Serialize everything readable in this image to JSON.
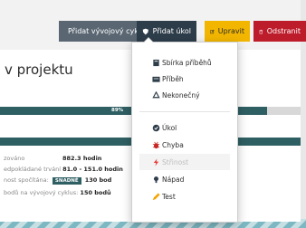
{
  "toolbar": {
    "add_cycle": "Přidat vývojový cyklus",
    "add_task": "Přidat úkol",
    "edit": "Upravit",
    "delete": "Odstranit"
  },
  "page": {
    "title_fragment": "v projektu",
    "progress_label": "89%",
    "progress_value": 0.89
  },
  "stats": {
    "row1_label": "zováno",
    "row1_value": "882.3 hodin",
    "row2_label": "edpokládané trvání",
    "row2_value": "81.0 - 151.0 hodin",
    "row3_label": "nost spočítána:",
    "row3_badge": "SNADNÉ",
    "row3_value": "130 bod",
    "row4_label": "bodů na vývojový cyklus:",
    "row4_value": "150 bodů"
  },
  "menu": {
    "items": [
      {
        "label": "Sbírka příběhů",
        "icon": "book-icon"
      },
      {
        "label": "Příběh",
        "icon": "card-icon"
      },
      {
        "label": "Nekonečný",
        "icon": "recycle-icon"
      },
      {
        "label": "Úkol",
        "icon": "check-circle-icon"
      },
      {
        "label": "Chyba",
        "icon": "bug-icon"
      },
      {
        "label": "Střinost",
        "icon": "lightning-icon"
      },
      {
        "label": "Nápad",
        "icon": "lightbulb-icon"
      },
      {
        "label": "Test",
        "icon": "pencil-icon"
      }
    ]
  },
  "colors": {
    "accent": "#2e5f63",
    "edit": "#f2b600",
    "delete": "#bd1c2b",
    "bug": "#c62828",
    "lightning": "#e53935",
    "test": "#f4a300"
  }
}
